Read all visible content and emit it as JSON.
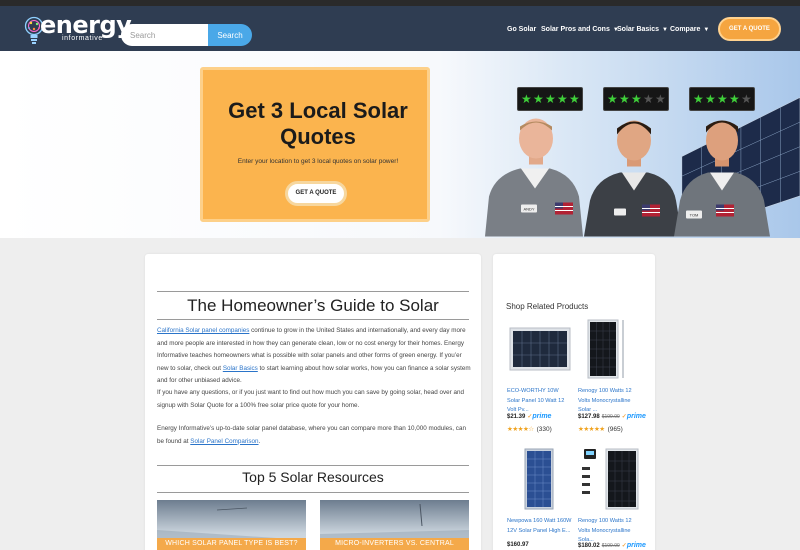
{
  "header": {
    "logo_word": "energy",
    "logo_sub": "informative",
    "search_placeholder": "Search",
    "search_button": "Search",
    "nav": [
      {
        "label": "Go Solar",
        "caret": ""
      },
      {
        "label": "Solar Pros and Cons",
        "caret": "▼"
      },
      {
        "label": "Solar Basics",
        "caret": "▼"
      },
      {
        "label": "Compare",
        "caret": "▼"
      }
    ],
    "quote_button": "GET A QUOTE"
  },
  "hero": {
    "title": "Get 3 Local Solar Quotes",
    "subtitle": "Enter your location to get 3 local quotes on solar power!",
    "button": "GET A QUOTE",
    "installers": [
      {
        "badge": "ANDY",
        "stars_filled": 5,
        "stars_total": 5
      },
      {
        "badge": "",
        "stars_filled": 3,
        "stars_total": 5
      },
      {
        "badge": "TOM",
        "stars_filled": 4,
        "stars_total": 5
      }
    ]
  },
  "main": {
    "title": "The Homeowner’s Guide to Solar",
    "p1": {
      "link1": "California Solar panel companies",
      "text1": " continue to grow in the United States and internationally, and every day more and more people are interested in how they can generate clean, low or no cost energy for their homes. Energy Informative teaches homeowners what is possible with solar panels and other forms of green energy. If you’er new to solar, check out ",
      "link2": "Solar Basics",
      "text2": " to start learning about how solar works, how you can finance a solar system and for other unbiased advice."
    },
    "p2": "If you have any questions, or if you just want to find out how much you can save by going solar, head over and signup with Solar Quote for a 100% free solar price quote for your home.",
    "p3": {
      "text1": "Energy Informative’s up-to-date solar panel database, where you can compare more than 10,000 modules, can be found at ",
      "link1": "Solar Panel Comparison",
      "text2": "."
    },
    "section_title": "Top 5 Solar Resources",
    "cards": [
      {
        "label": "WHICH SOLAR PANEL TYPE IS BEST?"
      },
      {
        "label": "MICRO-INVERTERS VS. CENTRAL"
      }
    ]
  },
  "sidebar": {
    "title": "Shop Related Products",
    "products": [
      {
        "name": "ECO-WORTHY 10W Solar Panel 10 Watt 12 Volt Pv...",
        "price": "$21.39",
        "old_price": "",
        "prime": true,
        "stars": 4,
        "rating_count": "(330)"
      },
      {
        "name": "Renogy 100 Watts 12 Volts Monocrystalline Solar ...",
        "price": "$127.98",
        "old_price": "$199.99",
        "prime": true,
        "stars": 4.5,
        "rating_count": "(965)"
      },
      {
        "name": "Newpowa 160 Watt 160W 12V Solar Panel High E...",
        "price": "$160.97",
        "old_price": "",
        "prime": false,
        "stars": 0,
        "rating_count": ""
      },
      {
        "name": "Renogy 100 Watts 12 Volts Monocrystalline Sola...",
        "price": "$180.02",
        "old_price": "$199.99",
        "prime": true,
        "stars": 0,
        "rating_count": ""
      }
    ],
    "prime_label": "prime"
  },
  "colors": {
    "header_bg": "#2f3d52",
    "accent_orange": "#f5a540",
    "search_blue": "#4aa8e8",
    "link_blue": "#2a74c9",
    "star_green": "#3fcf3a"
  }
}
